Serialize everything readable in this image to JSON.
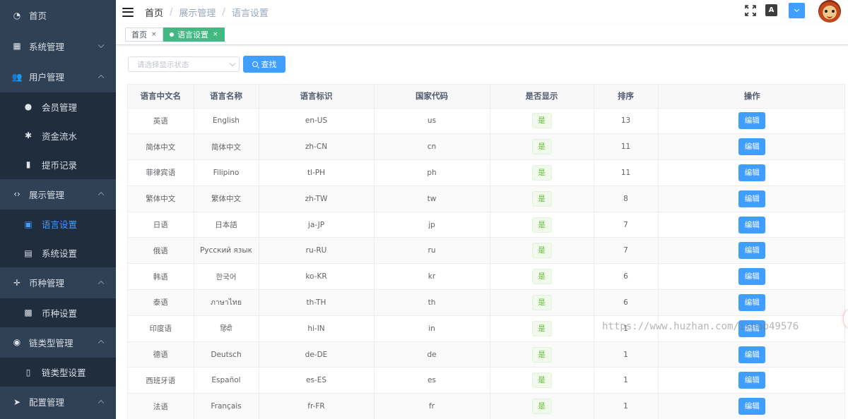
{
  "sidebar": {
    "items": [
      {
        "type": "group",
        "icon": "dashboard-icon",
        "label": "首页",
        "arrow": ""
      },
      {
        "type": "group",
        "icon": "grid-icon",
        "label": "系统管理",
        "arrow": "down"
      },
      {
        "type": "group",
        "icon": "users-icon",
        "label": "用户管理",
        "arrow": "up"
      },
      {
        "type": "sub",
        "icon": "user-icon",
        "label": "会员管理"
      },
      {
        "type": "sub",
        "icon": "bug-icon",
        "label": "资金流水"
      },
      {
        "type": "sub",
        "icon": "bar-chart-icon",
        "label": "提币记录"
      },
      {
        "type": "group",
        "icon": "code-icon",
        "label": "展示管理",
        "arrow": "up"
      },
      {
        "type": "sub",
        "icon": "calendar-icon",
        "label": "语言设置",
        "active": true
      },
      {
        "type": "sub",
        "icon": "document-icon",
        "label": "系统设置"
      },
      {
        "type": "group",
        "icon": "move-icon",
        "label": "币种管理",
        "arrow": "up"
      },
      {
        "type": "sub",
        "icon": "image-icon",
        "label": "币种设置"
      },
      {
        "type": "group",
        "icon": "chrome-icon",
        "label": "链类型管理",
        "arrow": "up"
      },
      {
        "type": "sub",
        "icon": "book-icon",
        "label": "链类型设置"
      },
      {
        "type": "group",
        "icon": "send-icon",
        "label": "配置管理",
        "arrow": "up"
      }
    ]
  },
  "header": {
    "breadcrumb": [
      "首页",
      "展示管理",
      "语言设置"
    ],
    "separator": "/",
    "lang_icon_text": "A"
  },
  "tags": [
    {
      "label": "首页",
      "active": false,
      "close": "×"
    },
    {
      "label": "语言设置",
      "active": true,
      "close": "×"
    }
  ],
  "filter": {
    "placeholder": "请选择显示状态",
    "search_label": "查找"
  },
  "table": {
    "columns": [
      "语言中文名",
      "语言名称",
      "语言标识",
      "国家代码",
      "是否显示",
      "排序",
      "操作"
    ],
    "rows": [
      [
        "英语",
        "English",
        "en-US",
        "us",
        "是",
        "13",
        "编辑"
      ],
      [
        "简体中文",
        "简体中文",
        "zh-CN",
        "cn",
        "是",
        "11",
        "编辑"
      ],
      [
        "菲律宾语",
        "Filipino",
        "tl-PH",
        "ph",
        "是",
        "11",
        "编辑"
      ],
      [
        "繁体中文",
        "繁体中文",
        "zh-TW",
        "tw",
        "是",
        "8",
        "编辑"
      ],
      [
        "日语",
        "日本語",
        "ja-JP",
        "jp",
        "是",
        "7",
        "编辑"
      ],
      [
        "俄语",
        "Русский язык",
        "ru-RU",
        "ru",
        "是",
        "7",
        "编辑"
      ],
      [
        "韩语",
        "한국어",
        "ko-KR",
        "kr",
        "是",
        "6",
        "编辑"
      ],
      [
        "泰语",
        "ภาษาไทย",
        "th-TH",
        "th",
        "是",
        "6",
        "编辑"
      ],
      [
        "印度语",
        "हिंदी",
        "hi-IN",
        "in",
        "是",
        "1",
        "编辑"
      ],
      [
        "德语",
        "Deutsch",
        "de-DE",
        "de",
        "是",
        "1",
        "编辑"
      ],
      [
        "西班牙语",
        "Español",
        "es-ES",
        "es",
        "是",
        "1",
        "编辑"
      ],
      [
        "法语",
        "Français",
        "fr-FR",
        "fr",
        "是",
        "1",
        "编辑"
      ]
    ]
  },
  "watermark": "https://www.huzhan.com/ishop49576",
  "colors": {
    "sidebar_bg": "#304156",
    "submenu_bg": "#1f2d3d",
    "primary": "#409eff",
    "tag_active": "#42b983",
    "success": "#67c23a"
  }
}
